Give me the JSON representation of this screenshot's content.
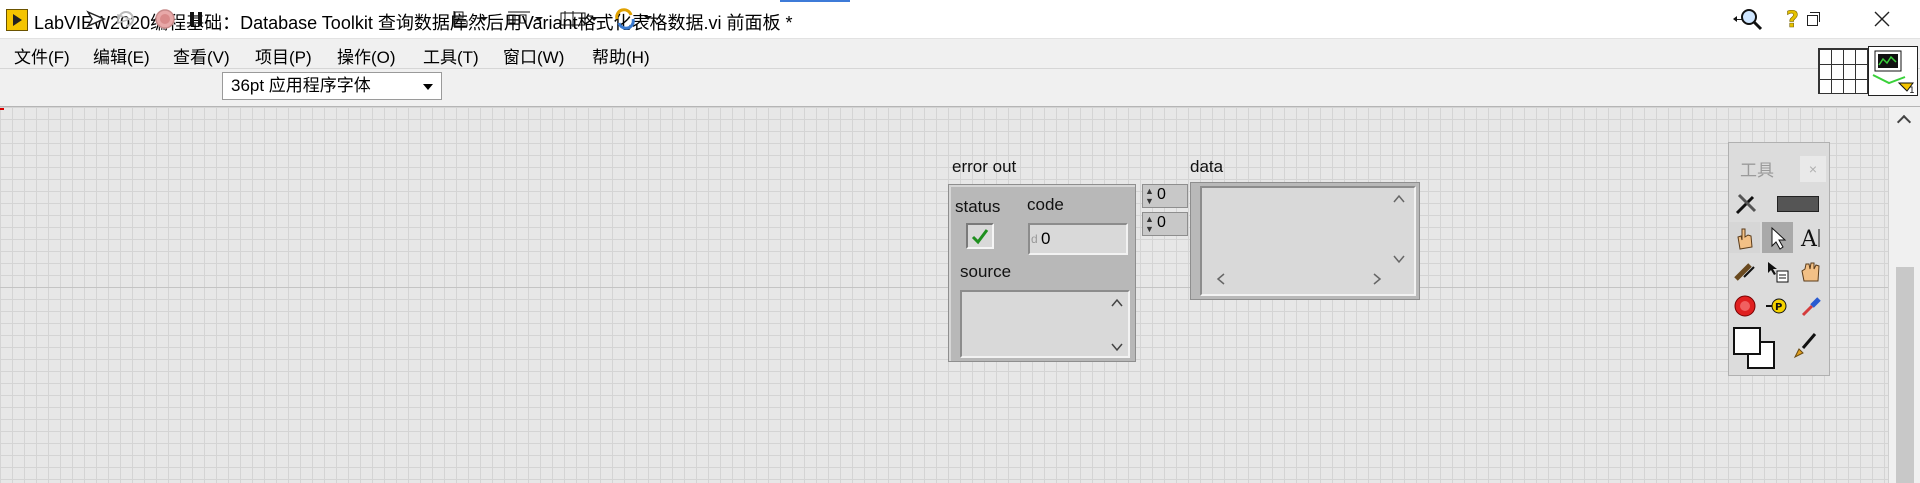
{
  "window": {
    "title": "LabVIEW2020编程基础：Database Toolkit 查询数据库然后用Variant格式化表格数据.vi 前面板 *"
  },
  "menu": [
    "文件(F)",
    "编辑(E)",
    "查看(V)",
    "项目(P)",
    "操作(O)",
    "工具(T)",
    "窗口(W)",
    "帮助(H)"
  ],
  "toolbar": {
    "font": "36pt 应用程序字体"
  },
  "front_panel": {
    "error_out": {
      "label": "error out",
      "status_label": "status",
      "code_label": "code",
      "code_value": "0",
      "code_radix": "d",
      "source_label": "source",
      "status_checked": true
    },
    "data": {
      "label": "data",
      "index_row": "0",
      "index_col": "0"
    }
  },
  "tools_palette": {
    "title": "工具",
    "close": "×"
  },
  "colors": {
    "panel_grid": "#d4d4d4",
    "panel_bg": "#e7e7e7",
    "accent_green": "#2fa12f"
  }
}
